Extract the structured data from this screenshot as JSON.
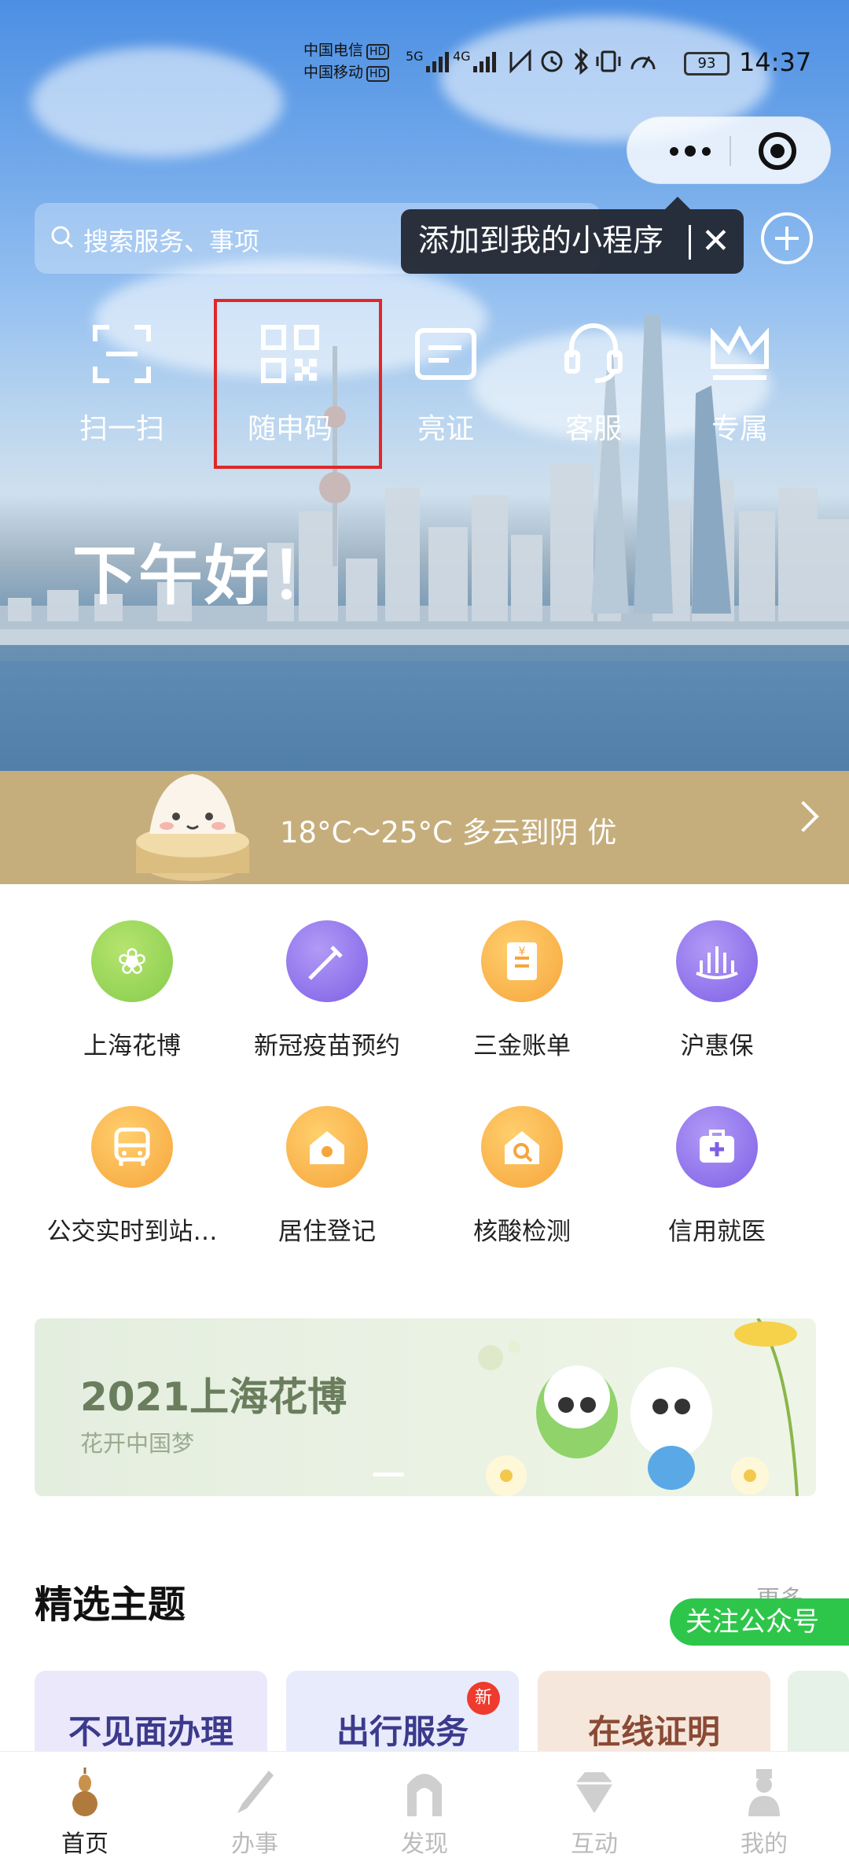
{
  "status_bar": {
    "carrier1": "中国电信",
    "carrier2": "中国移动",
    "hd": "HD",
    "net1": "5G",
    "net2": "4G",
    "battery": "93",
    "time": "14:37"
  },
  "header": {
    "search_placeholder": "搜索服务、事项",
    "tooltip_text": "添加到我的小程序",
    "tooltip_close": "✕"
  },
  "quick_actions": [
    {
      "label": "扫一扫",
      "icon": "scan-icon"
    },
    {
      "label": "随申码",
      "icon": "qr-code-icon"
    },
    {
      "label": "亮证",
      "icon": "id-card-icon"
    },
    {
      "label": "客服",
      "icon": "headset-icon"
    },
    {
      "label": "专属",
      "icon": "crown-icon"
    }
  ],
  "greeting": "下午好！",
  "weather": {
    "text": "18°C～25°C 多云到阴 优"
  },
  "services": [
    {
      "label": "上海花博",
      "icon": "flower-icon",
      "color": "#8ccf4f"
    },
    {
      "label": "新冠疫苗预约",
      "icon": "syringe-icon",
      "color": "#8468ea"
    },
    {
      "label": "三金账单",
      "icon": "bill-icon",
      "color": "#f8ab42"
    },
    {
      "label": "沪惠保",
      "icon": "lotus-icon",
      "color": "#8468ea"
    },
    {
      "label": "公交实时到站…",
      "icon": "bus-icon",
      "color": "#f8ab42"
    },
    {
      "label": "居住登记",
      "icon": "house-icon",
      "color": "#f8ab42"
    },
    {
      "label": "核酸检测",
      "icon": "test-icon",
      "color": "#f8ab42"
    },
    {
      "label": "信用就医",
      "icon": "medical-kit-icon",
      "color": "#8468ea"
    }
  ],
  "banner": {
    "title": "2021上海花博",
    "subtitle": "花开中国梦"
  },
  "featured": {
    "title": "精选主题",
    "more": "更多",
    "follow": "关注公众号",
    "badge": "新",
    "cards": [
      {
        "label": "不见面办理",
        "color": "#e9e6fb",
        "text_color": "#3b3a8c"
      },
      {
        "label": "出行服务",
        "color": "#e6e9fb",
        "text_color": "#3b3a8c"
      },
      {
        "label": "在线证明",
        "color": "#f6e6dc",
        "text_color": "#8a4a35"
      }
    ]
  },
  "tabs": [
    {
      "label": "首页",
      "icon": "gourd-icon",
      "active": true
    },
    {
      "label": "办事",
      "icon": "brush-icon",
      "active": false
    },
    {
      "label": "发现",
      "icon": "gate-icon",
      "active": false
    },
    {
      "label": "互动",
      "icon": "diamond-icon",
      "active": false
    },
    {
      "label": "我的",
      "icon": "person-icon",
      "active": false
    }
  ],
  "colors": {
    "accent_green": "#2dc64a",
    "highlight_red": "#e02828",
    "weather_bar": "#c6ae7c"
  }
}
